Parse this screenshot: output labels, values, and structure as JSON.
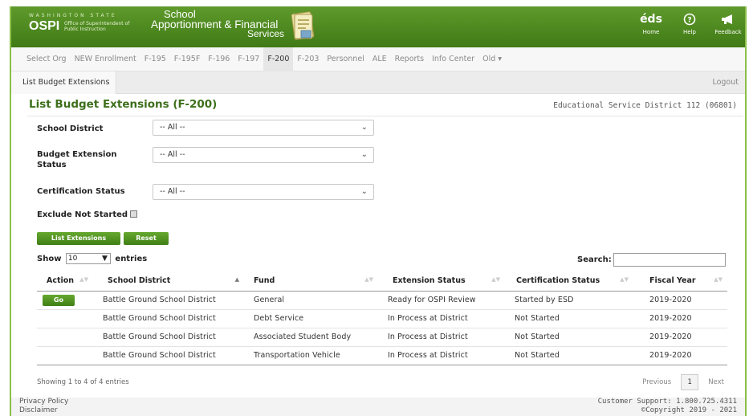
{
  "header": {
    "state_line": "WASHINGTON STATE",
    "logo": "OSPI",
    "logo_sub": "Office of Superintendent of Public Instruction",
    "app_title_1": "School",
    "app_title_2": "Apportionment & Financial",
    "app_title_3": "Services",
    "links": [
      {
        "label": "Home",
        "icon": "eds-home-icon",
        "glyph": "éds"
      },
      {
        "label": "Help",
        "icon": "help-icon",
        "glyph": "?"
      },
      {
        "label": "Feedback",
        "icon": "megaphone-icon",
        "glyph": "◀"
      }
    ],
    "colors": {
      "header": "#4a8a20",
      "accent": "#3d6f1b"
    }
  },
  "nav": {
    "items": [
      "Select Org",
      "NEW Enrollment",
      "F-195",
      "F-195F",
      "F-196",
      "F-197",
      "F-200",
      "F-203",
      "Personnel",
      "ALE",
      "Reports",
      "Info Center",
      "Old ▾"
    ],
    "active": "F-200"
  },
  "subnav": {
    "tab": "List Budget Extensions",
    "logout": "Logout"
  },
  "page": {
    "title": "List Budget Extensions (F-200)",
    "org": "Educational Service District 112 (06801)"
  },
  "filters": {
    "district_label": "School District",
    "district_value": "-- All --",
    "budget_label": "Budget Extension Status",
    "budget_value": "-- All --",
    "cert_label": "Certification Status",
    "cert_value": "-- All --",
    "exclude_label": "Exclude Not Started"
  },
  "buttons": {
    "list": "List Extensions",
    "reset": "Reset",
    "go": "Go"
  },
  "table_controls": {
    "show": "Show",
    "entries_value": "10",
    "entries": "entries",
    "search": "Search:"
  },
  "table": {
    "headers": [
      "Action",
      "School District",
      "Fund",
      "Extension Status",
      "Certification Status",
      "Fiscal Year"
    ],
    "rows": [
      [
        "Battle Ground School District",
        "General",
        "Ready for OSPI Review",
        "Started by ESD",
        "2019-2020"
      ],
      [
        "Battle Ground School District",
        "Debt Service",
        "In Process at District",
        "Not Started",
        "2019-2020"
      ],
      [
        "Battle Ground School District",
        "Associated Student Body",
        "In Process at District",
        "Not Started",
        "2019-2020"
      ],
      [
        "Battle Ground School District",
        "Transportation Vehicle",
        "In Process at District",
        "Not Started",
        "2019-2020"
      ]
    ]
  },
  "pagination": {
    "info": "Showing 1 to 4 of 4 entries",
    "previous": "Previous",
    "page": "1",
    "next": "Next"
  },
  "footer": {
    "privacy": "Privacy Policy",
    "disclaimer": "Disclaimer",
    "support": "Customer Support: 1.800.725.4311",
    "copyright": "©Copyright 2019 - 2021"
  }
}
